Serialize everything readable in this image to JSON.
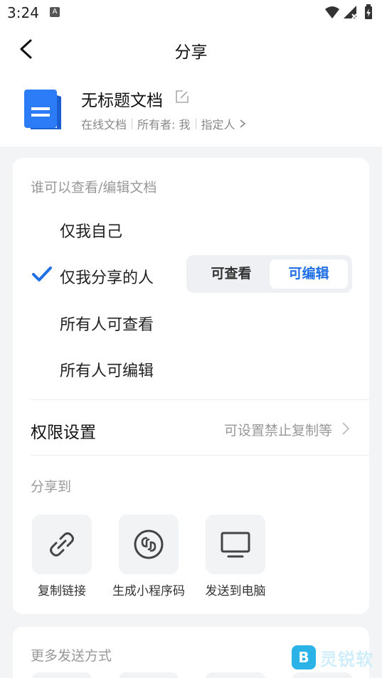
{
  "status_bar": {
    "time": "3:24",
    "notification_icon_letter": "A"
  },
  "nav": {
    "title": "分享"
  },
  "document": {
    "title": "无标题文档",
    "type": "在线文档",
    "owner": "所有者: 我",
    "assignee": "指定人"
  },
  "visibility": {
    "section_title": "谁可以查看/编辑文档",
    "options": [
      {
        "label": "仅我自己",
        "selected": false
      },
      {
        "label": "仅我分享的人",
        "selected": true
      },
      {
        "label": "所有人可查看",
        "selected": false
      },
      {
        "label": "所有人可编辑",
        "selected": false
      }
    ],
    "segmented": {
      "view_label": "可查看",
      "edit_label": "可编辑",
      "active": "可编辑"
    }
  },
  "permissions": {
    "label": "权限设置",
    "value": "可设置禁止复制等"
  },
  "share_to": {
    "section_title": "分享到",
    "items": [
      {
        "label": "复制链接",
        "icon": "link-icon"
      },
      {
        "label": "生成小程序码",
        "icon": "mini-program-icon"
      },
      {
        "label": "发送到电脑",
        "icon": "monitor-icon"
      }
    ]
  },
  "more": {
    "section_title": "更多发送方式"
  },
  "watermark": {
    "logo_letter": "B",
    "text": "灵锐软"
  },
  "colors": {
    "accent": "#1f6fe6",
    "doc_icon": "#2b7cf6",
    "background": "#f3f4f6"
  }
}
